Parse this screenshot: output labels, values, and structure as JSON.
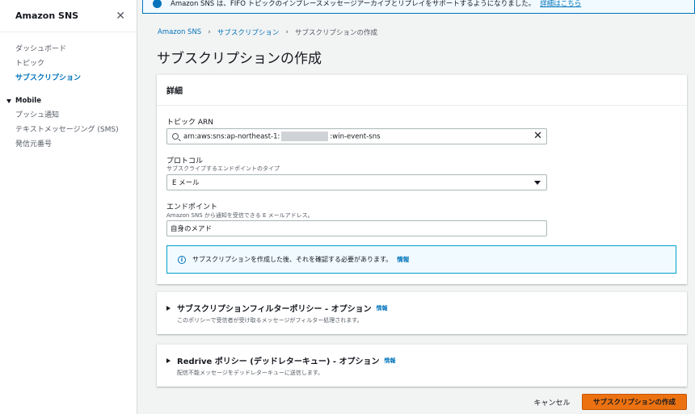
{
  "colors": {
    "link": "#0073bb",
    "primary_button": "#ec7211",
    "info_border": "#00a1c9",
    "background": "#f2f3f3"
  },
  "sidebar": {
    "title": "Amazon SNS",
    "close_icon": "close-icon",
    "items": [
      {
        "label": "ダッシュボード",
        "active": false
      },
      {
        "label": "トピック",
        "active": false
      },
      {
        "label": "サブスクリプション",
        "active": true
      }
    ],
    "mobile_section": {
      "label": "Mobile",
      "items": [
        {
          "label": "プッシュ通知"
        },
        {
          "label": "テキストメッセージング (SMS)"
        },
        {
          "label": "発信元番号"
        }
      ]
    }
  },
  "flash": {
    "text": "Amazon SNS は、FIFO トピックのインプレースメッセージアーカイブとリプレイをサポートするようになりました。",
    "link": "詳細はこちら"
  },
  "breadcrumb": {
    "items": [
      "Amazon SNS",
      "サブスクリプション"
    ],
    "current": "サブスクリプションの作成"
  },
  "page_title": "サブスクリプションの作成",
  "details": {
    "header": "詳細",
    "topic_arn": {
      "label": "トピック ARN",
      "value_prefix": "arn:aws:sns:ap-northeast-1:",
      "value_suffix": ":win-event-sns"
    },
    "protocol": {
      "label": "プロトコル",
      "description": "サブスクライブするエンドポイントのタイプ",
      "selected": "E メール"
    },
    "endpoint": {
      "label": "エンドポイント",
      "description": "Amazon SNS から通知を受信できる E メールアドレス。",
      "value": "自身のメアド"
    },
    "info": {
      "text": "サブスクリプションを作成した後、それを確認する必要があります。",
      "link": "情報"
    }
  },
  "filter_policy": {
    "title": "サブスクリプションフィルターポリシー - オプション",
    "info": "情報",
    "description": "このポリシーで受信者が受け取るメッセージがフィルター処理されます。"
  },
  "redrive_policy": {
    "title": "Redrive ポリシー (デッドレターキュー) - オプション",
    "info": "情報",
    "description": "配信不能メッセージをデッドレターキューに送信します。"
  },
  "footer": {
    "cancel": "キャンセル",
    "create": "サブスクリプションの作成"
  }
}
